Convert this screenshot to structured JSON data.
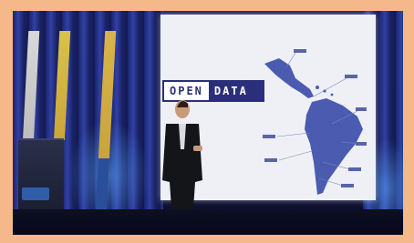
{
  "image": {
    "kind": "photo",
    "scene": "conference-presentation",
    "slide": {
      "title_part1": "OPEN",
      "title_part2": "DATA",
      "accent_color": "#2b2f7a",
      "background_color": "#eef0f6",
      "map_color": "#4a5bb0"
    },
    "frame_color": "#f5b88a"
  }
}
